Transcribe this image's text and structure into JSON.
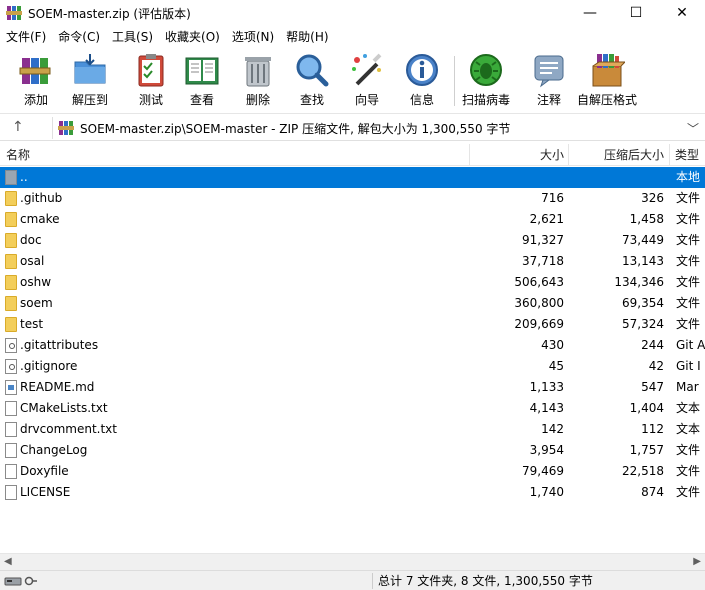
{
  "window": {
    "title": "SOEM-master.zip (评估版本)",
    "controls": {
      "minimize": "—",
      "maximize": "☐",
      "close": "✕"
    }
  },
  "menu": [
    {
      "label": "文件(F)"
    },
    {
      "label": "命令(C)"
    },
    {
      "label": "工具(S)"
    },
    {
      "label": "收藏夹(O)"
    },
    {
      "label": "选项(N)"
    },
    {
      "label": "帮助(H)"
    }
  ],
  "toolbar": [
    {
      "label": "添加",
      "icon": "add-archive-icon"
    },
    {
      "label": "解压到",
      "icon": "extract-to-icon"
    },
    {
      "label": "测试",
      "icon": "test-clipboard-icon"
    },
    {
      "label": "查看",
      "icon": "view-book-icon"
    },
    {
      "label": "删除",
      "icon": "trash-icon"
    },
    {
      "label": "查找",
      "icon": "magnifier-icon"
    },
    {
      "label": "向导",
      "icon": "wizard-wand-icon"
    },
    {
      "label": "信息",
      "icon": "info-icon"
    },
    {
      "label": "扫描病毒",
      "icon": "virus-scan-icon"
    },
    {
      "label": "注释",
      "icon": "comment-icon"
    },
    {
      "label": "自解压格式",
      "icon": "sfx-box-icon"
    }
  ],
  "address": {
    "up_arrow": "↑",
    "path": "SOEM-master.zip\\SOEM-master - ZIP 压缩文件, 解包大小为 1,300,550 字节",
    "chevron": "﹀"
  },
  "columns": {
    "name": "名称",
    "size": "大小",
    "packed": "压缩后大小",
    "type": "类型"
  },
  "files": [
    {
      "name": "..",
      "size": "",
      "packed": "",
      "type": "本地",
      "icon": "up-folder",
      "selected": true
    },
    {
      "name": ".github",
      "size": "716",
      "packed": "326",
      "type": "文件",
      "icon": "folder"
    },
    {
      "name": "cmake",
      "size": "2,621",
      "packed": "1,458",
      "type": "文件",
      "icon": "folder"
    },
    {
      "name": "doc",
      "size": "91,327",
      "packed": "73,449",
      "type": "文件",
      "icon": "folder"
    },
    {
      "name": "osal",
      "size": "37,718",
      "packed": "13,143",
      "type": "文件",
      "icon": "folder"
    },
    {
      "name": "oshw",
      "size": "506,643",
      "packed": "134,346",
      "type": "文件",
      "icon": "folder"
    },
    {
      "name": "soem",
      "size": "360,800",
      "packed": "69,354",
      "type": "文件",
      "icon": "folder"
    },
    {
      "name": "test",
      "size": "209,669",
      "packed": "57,324",
      "type": "文件",
      "icon": "folder"
    },
    {
      "name": ".gitattributes",
      "size": "430",
      "packed": "244",
      "type": "Git A",
      "icon": "config-file"
    },
    {
      "name": ".gitignore",
      "size": "45",
      "packed": "42",
      "type": "Git I",
      "icon": "config-file"
    },
    {
      "name": "README.md",
      "size": "1,133",
      "packed": "547",
      "type": "Mar",
      "icon": "markdown-file"
    },
    {
      "name": "CMakeLists.txt",
      "size": "4,143",
      "packed": "1,404",
      "type": "文本",
      "icon": "text-file"
    },
    {
      "name": "drvcomment.txt",
      "size": "142",
      "packed": "112",
      "type": "文本",
      "icon": "text-file"
    },
    {
      "name": "ChangeLog",
      "size": "3,954",
      "packed": "1,757",
      "type": "文件",
      "icon": "file"
    },
    {
      "name": "Doxyfile",
      "size": "79,469",
      "packed": "22,518",
      "type": "文件",
      "icon": "file"
    },
    {
      "name": "LICENSE",
      "size": "1,740",
      "packed": "874",
      "type": "文件",
      "icon": "file"
    }
  ],
  "scrollbar": {
    "left": "◀",
    "right": "▶"
  },
  "status": {
    "summary": "总计 7 文件夹, 8 文件, 1,300,550 字节"
  },
  "colors": {
    "selection": "#0078d7",
    "folder": "#f3ce5a"
  }
}
